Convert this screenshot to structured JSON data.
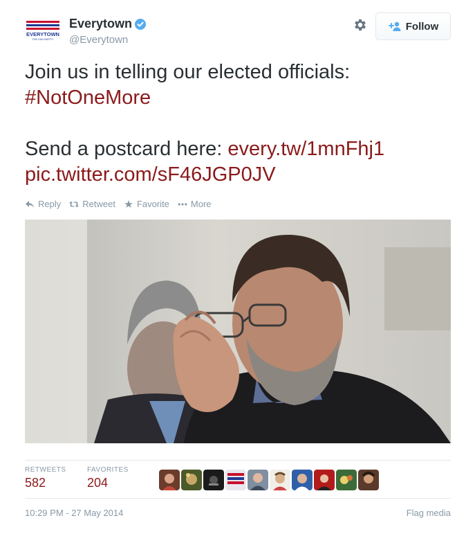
{
  "user": {
    "display_name": "Everytown",
    "handle": "@Everytown",
    "avatar_text": "EVERYTOWN",
    "avatar_subtext": "FOR GUN SAFETY"
  },
  "follow_label": "Follow",
  "tweet": {
    "line1": "Join us in telling our elected officials:",
    "hashtag": "#NotOneMore",
    "line3_prefix": "Send a postcard here: ",
    "short_link": "every.tw/1mnFhj1",
    "pic_link": "pic.twitter.com/sF46JGP0JV"
  },
  "actions": {
    "reply": "Reply",
    "retweet": "Retweet",
    "favorite": "Favorite",
    "more": "More"
  },
  "stats": {
    "retweets_label": "RETWEETS",
    "retweets_value": "582",
    "favorites_label": "FAVORITES",
    "favorites_value": "204"
  },
  "favoriters_count": 9,
  "timestamp": "10:29 PM - 27 May 2014",
  "flag_label": "Flag media",
  "colors": {
    "link": "#8b1a1a",
    "muted": "#8899a6",
    "text": "#292f33"
  }
}
